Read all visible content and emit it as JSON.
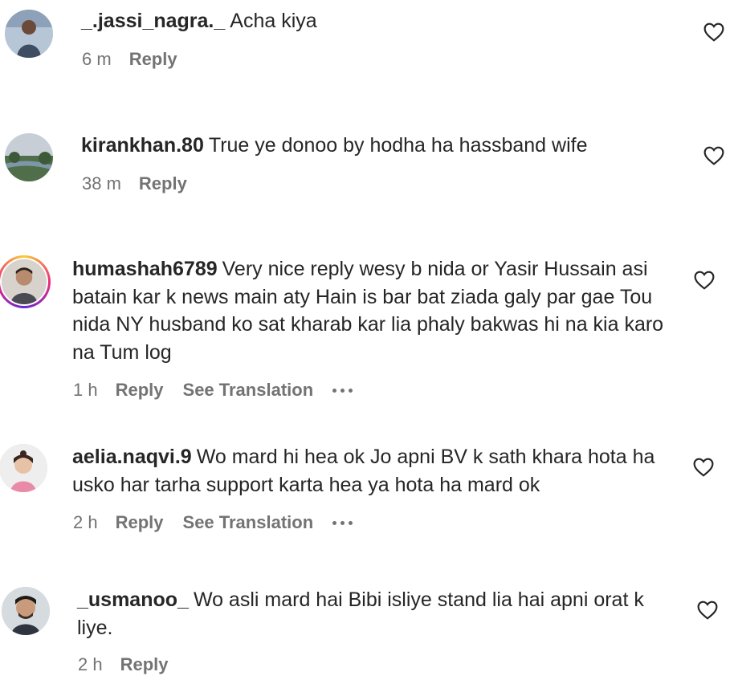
{
  "comments": [
    {
      "username": "_.jassi_nagra._",
      "text": "Acha kiya",
      "time": "6 m",
      "reply_label": "Reply",
      "avatar_icon": "profile-photo",
      "has_translation": false
    },
    {
      "username": "kirankhan.80",
      "text": "True ye donoo by hodha ha hassband wife",
      "time": "38 m",
      "reply_label": "Reply",
      "avatar_icon": "profile-photo",
      "has_translation": false
    },
    {
      "username": "humashah6789",
      "text": "Very nice reply wesy b nida or Yasir Hussain asi batain kar k news main aty Hain is bar bat ziada galy par gae Tou nida NY husband ko sat kharab kar lia phaly bakwas hi na kia karo na Tum log",
      "time": "1 h",
      "reply_label": "Reply",
      "translation_label": "See Translation",
      "avatar_icon": "profile-photo-with-story-ring",
      "has_translation": true
    },
    {
      "username": "aelia.naqvi.9",
      "text": "Wo mard hi hea ok Jo apni BV k sath khara hota ha usko har tarha support karta hea ya hota ha mard ok",
      "time": "2 h",
      "reply_label": "Reply",
      "translation_label": "See Translation",
      "avatar_icon": "profile-photo",
      "has_translation": true
    },
    {
      "username": "_usmanoo_",
      "text": "Wo asli mard hai Bibi isliye stand lia hai apni orat k liye.",
      "time": "2 h",
      "reply_label": "Reply",
      "avatar_icon": "profile-photo",
      "has_translation": false
    }
  ],
  "colors": {
    "text_primary": "#262626",
    "text_secondary": "#737373",
    "story_ring_gradient": [
      "#f9ce34",
      "#ee2a7b",
      "#6228d7"
    ]
  }
}
